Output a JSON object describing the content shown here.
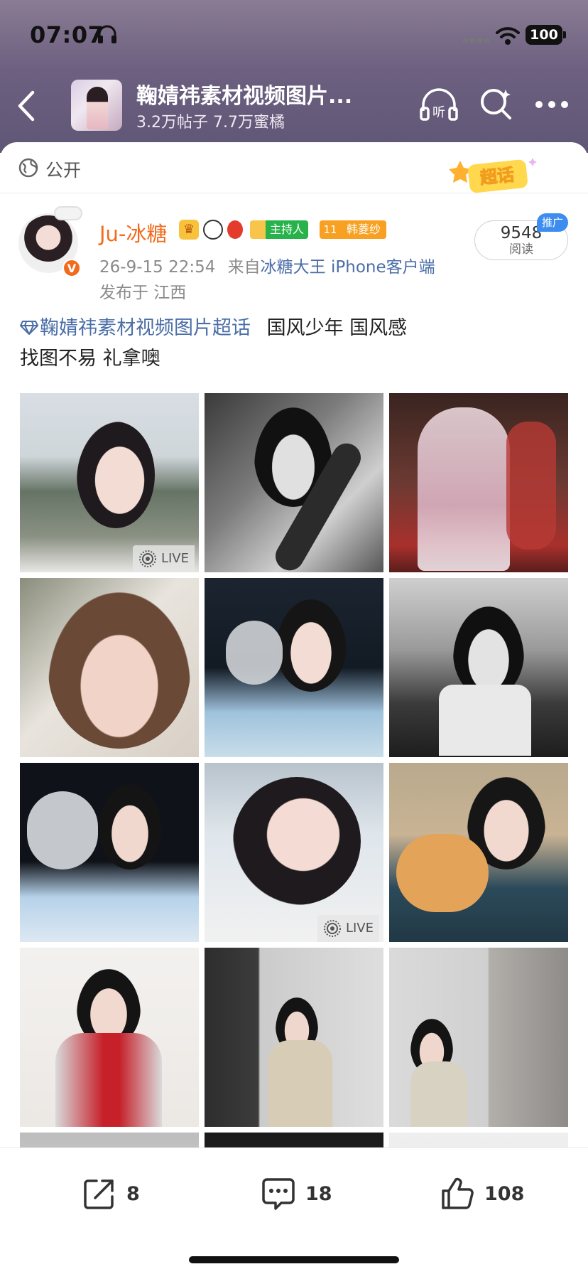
{
  "status_bar": {
    "time": "07:07",
    "battery": "100"
  },
  "topic": {
    "title": "鞠婧祎素材视频图片...",
    "stats": "3.2万帖子 7.7万蜜橘"
  },
  "visibility": {
    "label": "公开",
    "badge_text": "超话"
  },
  "author": {
    "name": "Ju-冰糖",
    "host_badge": "主持人",
    "fan_badge_level": "11",
    "fan_badge_name": "韩菱纱",
    "time": "26-9-15 22:54",
    "source_prefix": "来自",
    "source_client": "冰糖大王 iPhone客户端",
    "location": "发布于 江西"
  },
  "read": {
    "count": "9548",
    "label": "阅读",
    "promo": "推广"
  },
  "post": {
    "topic_link": "鞠婧祎素材视频图片超话",
    "line1_rest": "国风少年 国风感",
    "line2": "找图不易 礼拿噢"
  },
  "photos": {
    "live_label": "LIVE"
  },
  "actions": {
    "share_count": "8",
    "comment_count": "18",
    "like_count": "108"
  },
  "colors": {
    "accent_orange": "#f26b1d",
    "link_blue": "#4b6ea8",
    "header_purple": "#6d6081"
  }
}
